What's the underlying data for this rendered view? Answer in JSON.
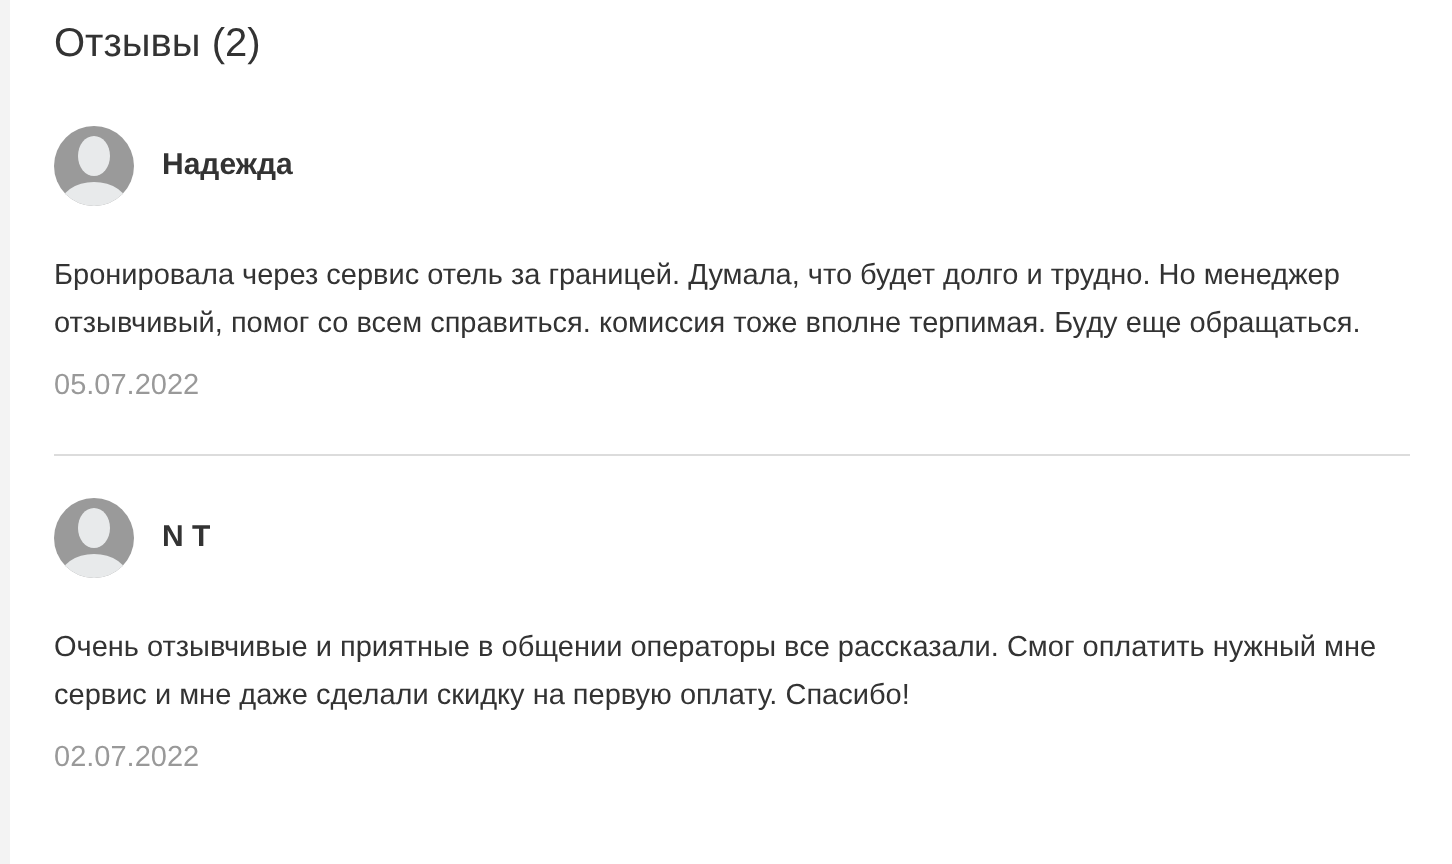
{
  "title": "Отзывы (2)",
  "reviews": [
    {
      "author": "Надежда",
      "text": "Бронировала через сервис отель за границей. Думала, что будет долго и трудно. Но менеджер отзывчивый, помог со всем справиться. комиссия тоже вполне терпимая. Буду еще обращаться.",
      "date": "05.07.2022"
    },
    {
      "author": "N T",
      "text": "Очень отзывчивые и приятные в общении операторы все рассказали. Смог оплатить нужный мне сервис и мне даже сделали скидку на первую оплату. Спасибо!",
      "date": "02.07.2022"
    }
  ]
}
